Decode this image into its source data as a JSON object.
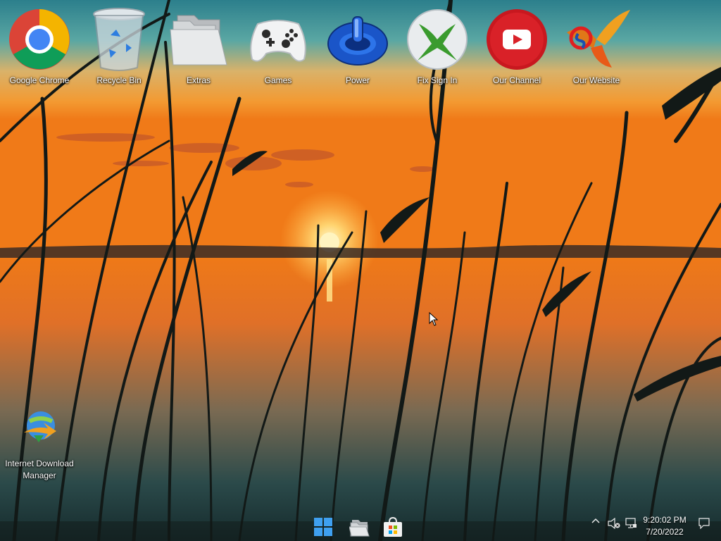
{
  "desktop": {
    "icons": [
      {
        "label": "Google Chrome",
        "icon": "chrome-icon"
      },
      {
        "label": "Recycle Bin",
        "icon": "recycle-bin-icon"
      },
      {
        "label": "Extras",
        "icon": "folder-icon"
      },
      {
        "label": "Games",
        "icon": "gamepad-icon"
      },
      {
        "label": "Power",
        "icon": "power-icon"
      },
      {
        "label": "Fix Sign In",
        "icon": "xbox-icon"
      },
      {
        "label": "Our Channel",
        "icon": "youtube-icon"
      },
      {
        "label": "Our Website",
        "icon": "phoenix-logo-icon"
      },
      {
        "label": "Internet Download Manager",
        "icon": "idm-icon"
      }
    ]
  },
  "taskbar": {
    "pinned": [
      {
        "name": "Start",
        "icon": "windows-start-icon"
      },
      {
        "name": "File Explorer",
        "icon": "file-explorer-icon"
      },
      {
        "name": "Microsoft Store",
        "icon": "store-icon"
      }
    ],
    "tray_icons": [
      "chevron-up-icon",
      "volume-muted-icon",
      "network-icon",
      "notification-icon"
    ],
    "time": "9:20:02 PM",
    "date": "7/20/2022"
  },
  "colors": {
    "sky_top": "#2f8a9a",
    "sky_mid": "#f0a040",
    "sun": "#ffd27a",
    "water": "#d96a1a",
    "reeds": "#111816"
  }
}
